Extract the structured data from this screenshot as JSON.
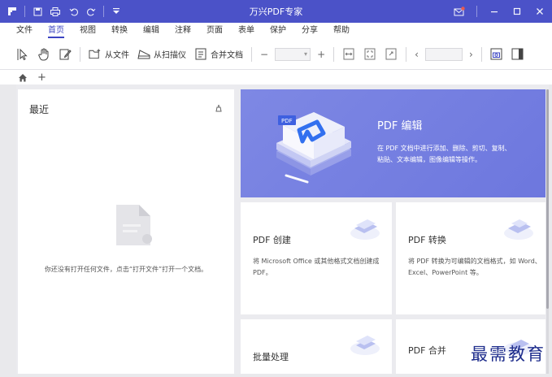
{
  "window": {
    "title": "万兴PDF专家"
  },
  "menu": [
    "文件",
    "首页",
    "视图",
    "转换",
    "编辑",
    "注释",
    "页面",
    "表单",
    "保护",
    "分享",
    "帮助"
  ],
  "menu_active_index": 1,
  "toolbar": {
    "open_file": "从文件",
    "from_scanner": "从扫描仪",
    "merge_files": "合并文档",
    "zoom_minus": "−",
    "zoom_plus": "+",
    "page_prev": "‹",
    "page_next": "›"
  },
  "tabs": {
    "add": "+"
  },
  "recent": {
    "title": "最近",
    "empty_message": "你还没有打开任何文件，点击“打开文件”打开一个文档。"
  },
  "hero": {
    "title": "PDF 编辑",
    "desc": "在 PDF 文档中进行添加、删除、剪切、复制、粘贴、文本编辑，图像编辑等操作。"
  },
  "cards": [
    {
      "title": "PDF 创建",
      "desc": "将 Microsoft Office 或其他格式文档创建成 PDF。"
    },
    {
      "title": "PDF 转换",
      "desc": "将 PDF 转换为可编辑的文档格式，如 Word、Excel、PowerPoint 等。"
    },
    {
      "title": "批量处理",
      "desc": ""
    },
    {
      "title": "PDF 合并",
      "desc": ""
    }
  ],
  "watermark": "最需教育",
  "colors": {
    "titlebar": "#4b52c8",
    "accent": "#3b44c2",
    "hero": "#7680e0"
  }
}
